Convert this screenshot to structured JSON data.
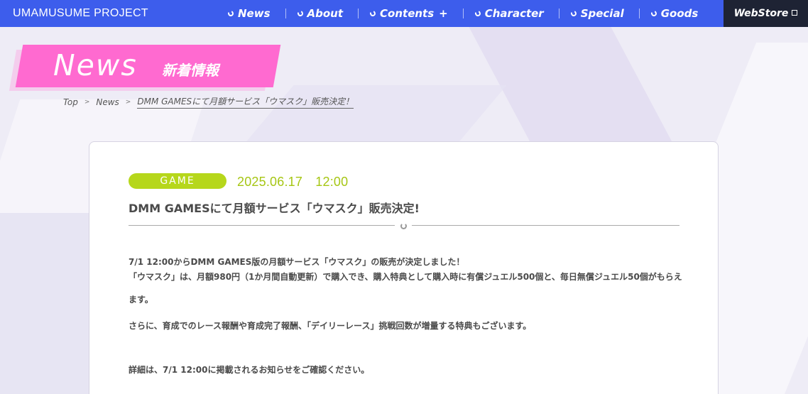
{
  "header": {
    "brand": "UMAMUSUME PROJECT",
    "nav": [
      {
        "label": "News"
      },
      {
        "label": "About"
      },
      {
        "label": "Contents"
      },
      {
        "label": "Character"
      },
      {
        "label": "Special"
      },
      {
        "label": "Goods"
      }
    ],
    "webstore": "WebStore",
    "colors": {
      "bar": "#3d5dec",
      "webstore_bg": "#1e2334"
    }
  },
  "banner": {
    "title": "News",
    "subtitle": "新着情報",
    "color": "#ff6ad0"
  },
  "breadcrumb": {
    "items": [
      "Top",
      "News"
    ],
    "current": "DMM GAMESにて月額サービス「ウマスク」販売決定！"
  },
  "article": {
    "tag": "GAME",
    "date": "2025.06.17　12:00",
    "title": "DMM GAMESにて月額サービス「ウマスク」販売決定!",
    "paragraphs": [
      "7/1 12:00からDMM GAMES版の月額サービス「ウマスク」の販売が決定しました！",
      "「ウマスク」は、月額980円（1か月間自動更新）で購入でき、購入特典として購入時に有償ジュエル500個と、毎日無償ジュエル50個がもらえます。",
      "さらに、育成でのレース報酬や育成完了報酬、「デイリーレース」挑戦回数が増量する特典もございます。",
      "詳細は、7/1 12:00に掲載されるお知らせをご確認ください。"
    ],
    "colors": {
      "tag": "#b6d71b",
      "date": "#a6c614"
    }
  }
}
